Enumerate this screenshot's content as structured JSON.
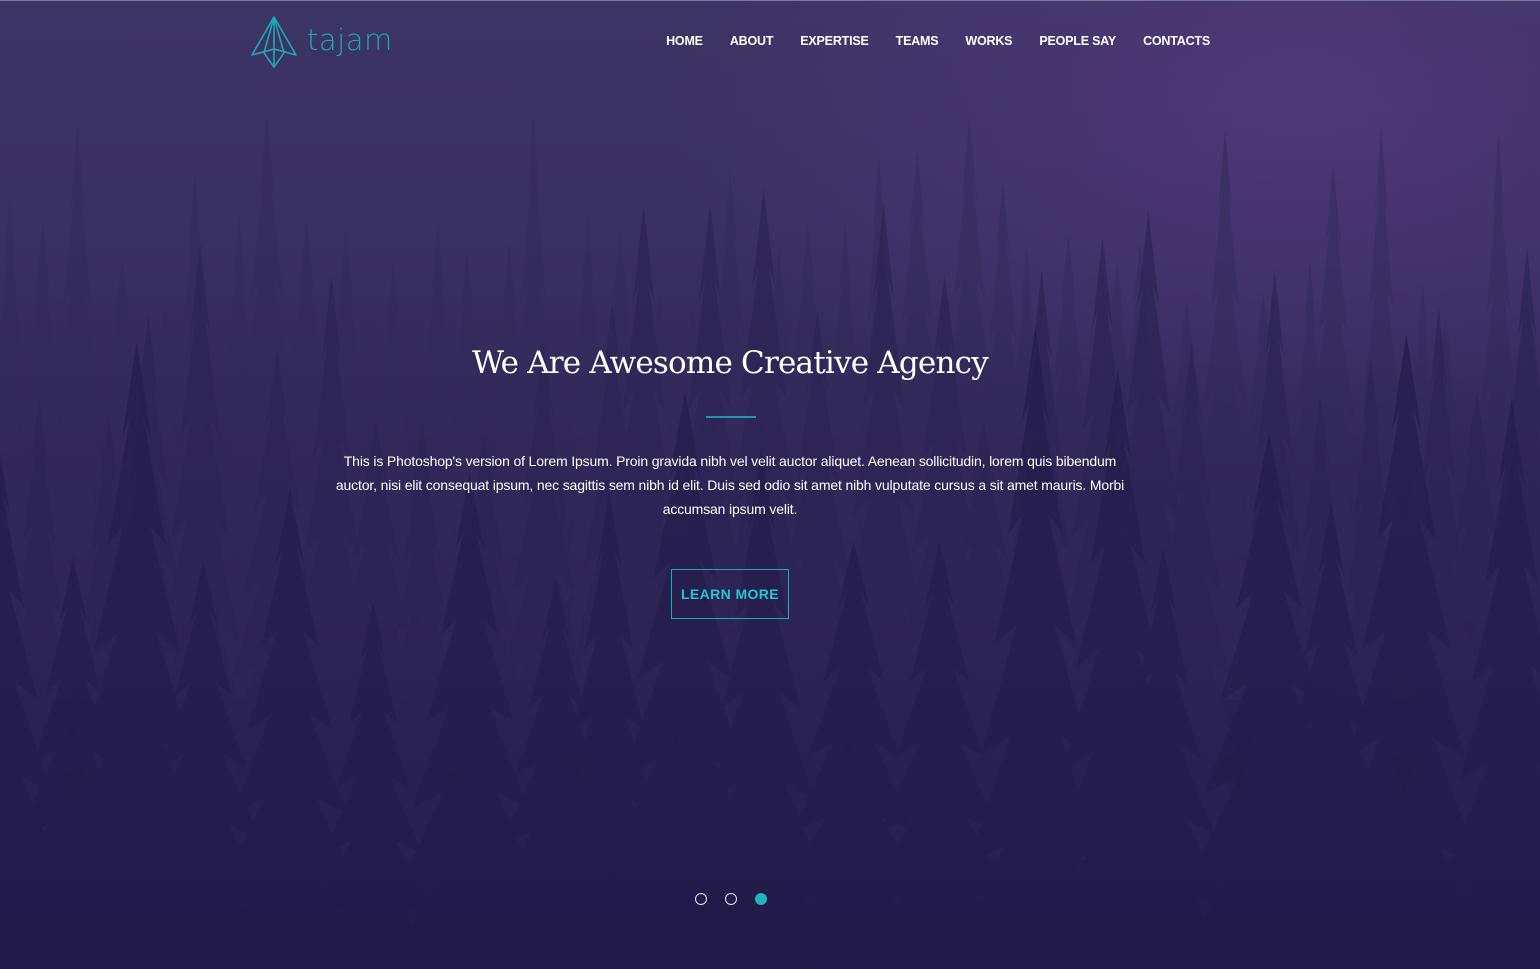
{
  "brand": {
    "name": "tajam",
    "logo_icon": "paper-plane-logo-icon",
    "accent_color": "#1aa9b7"
  },
  "nav": {
    "items": [
      {
        "label": "HOME"
      },
      {
        "label": "ABOUT"
      },
      {
        "label": "EXPERTISE"
      },
      {
        "label": "TEAMS"
      },
      {
        "label": "WORKS"
      },
      {
        "label": "PEOPLE SAY"
      },
      {
        "label": "CONTACTS"
      }
    ]
  },
  "hero": {
    "headline": "We Are Awesome Creative Agency",
    "description": "This is Photoshop's version of Lorem Ipsum. Proin gravida nibh vel velit auctor aliquet. Aenean sollicitudin, lorem quis bibendum auctor, nisi elit consequat ipsum, nec sagittis sem nibh id elit. Duis sed odio sit amet nibh vulputate cursus a sit amet mauris. Morbi accumsan ipsum velit.",
    "cta_label": "LEARN MORE",
    "background": "misty purple forest"
  },
  "slider": {
    "slide_count": 3,
    "active_index": 2
  }
}
